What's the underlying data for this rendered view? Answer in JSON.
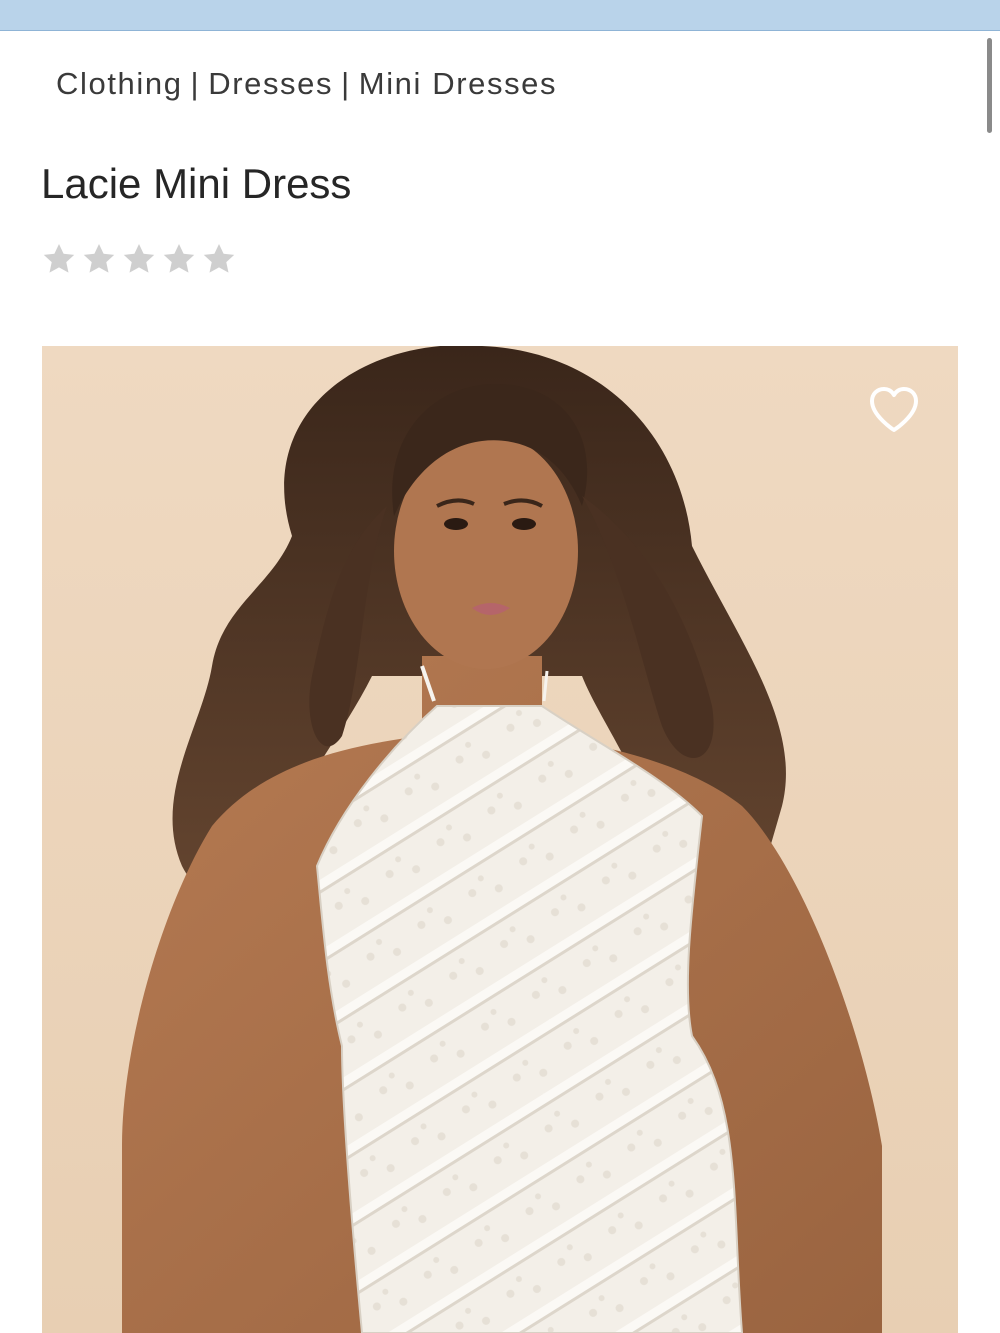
{
  "breadcrumb": {
    "items": [
      "Clothing",
      "Dresses",
      "Mini Dresses"
    ],
    "separator": "|"
  },
  "product": {
    "title": "Lacie Mini Dress",
    "rating": {
      "value": 0,
      "max": 5,
      "star_color_empty": "#cfcfcf"
    }
  },
  "hero": {
    "image": "model-photo",
    "background_color": "#ecd6bd",
    "wishlist_icon": "heart-outline-icon"
  },
  "colors": {
    "top_bar": "#b9d3ea",
    "text": "#2b2b2b"
  }
}
